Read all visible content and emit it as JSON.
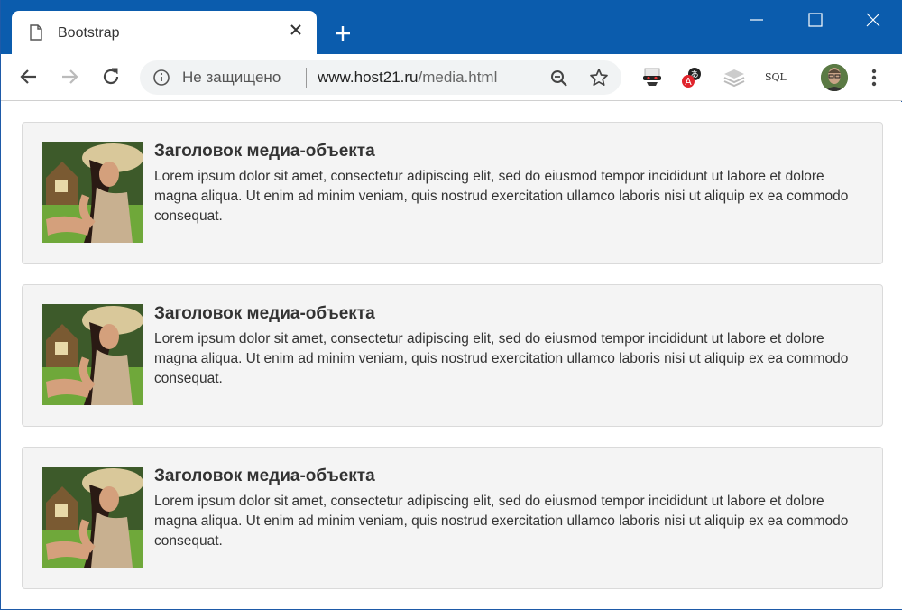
{
  "browser": {
    "tab_title": "Bootstrap",
    "security_label": "Не защищено",
    "url_host": "www.host21.ru",
    "url_path": "/media.html",
    "ext_sql_label": "SQL"
  },
  "colors": {
    "titlebar": "#0b5cad",
    "panel_bg": "#f4f4f4",
    "text": "#333333"
  },
  "media_items": [
    {
      "heading": "Заголовок медиа-объекта",
      "text": "Lorem ipsum dolor sit amet, consectetur adipiscing elit, sed do eiusmod tempor incididunt ut labore et dolore magna aliqua. Ut enim ad minim veniam, quis nostrud exercitation ullamco laboris nisi ut aliquip ex ea commodo consequat."
    },
    {
      "heading": "Заголовок медиа-объекта",
      "text": "Lorem ipsum dolor sit amet, consectetur adipiscing elit, sed do eiusmod tempor incididunt ut labore et dolore magna aliqua. Ut enim ad minim veniam, quis nostrud exercitation ullamco laboris nisi ut aliquip ex ea commodo consequat."
    },
    {
      "heading": "Заголовок медиа-объекта",
      "text": "Lorem ipsum dolor sit amet, consectetur adipiscing elit, sed do eiusmod tempor incididunt ut labore et dolore magna aliqua. Ut enim ad minim veniam, quis nostrud exercitation ullamco laboris nisi ut aliquip ex ea commodo consequat."
    }
  ]
}
